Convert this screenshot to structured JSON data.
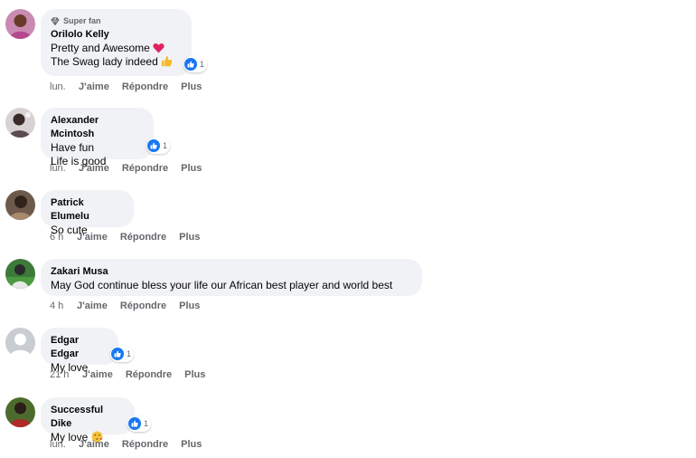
{
  "comments": [
    {
      "author": "Orilolo Kelly",
      "badge": "Super fan",
      "lines": [
        "Pretty and Awesome",
        "The Swag lady indeed"
      ],
      "reactions": "1",
      "time": "lun.",
      "actions": [
        "J'aime",
        "Répondre",
        "Plus"
      ]
    },
    {
      "author": "Alexander Mcintosh",
      "lines": [
        "Have fun",
        "Life is good"
      ],
      "reactions": "1",
      "time": "lun.",
      "actions": [
        "J'aime",
        "Répondre",
        "Plus"
      ]
    },
    {
      "author": "Patrick Elumelu",
      "lines": [
        "So cute"
      ],
      "time": "6 h",
      "actions": [
        "J'aime",
        "Répondre",
        "Plus"
      ]
    },
    {
      "author": "Zakari Musa",
      "lines": [
        "May God continue bless your life our African best player and world best"
      ],
      "time": "4 h",
      "actions": [
        "J'aime",
        "Répondre",
        "Plus"
      ]
    },
    {
      "author": "Edgar Edgar",
      "lines": [
        "My love"
      ],
      "reactions": "1",
      "time": "21 h",
      "actions": [
        "J'aime",
        "Répondre",
        "Plus"
      ]
    },
    {
      "author": "Successful Dike",
      "lines": [
        "My love"
      ],
      "reactions": "1",
      "time": "lun.",
      "actions": [
        "J'aime",
        "Répondre",
        "Plus"
      ]
    }
  ],
  "icons": {
    "reaction": "like-icon",
    "badge": "diamond-icon",
    "emoji_heart": "red-heart-emoji",
    "emoji_thumb": "thumbs-up-emoji",
    "emoji_kiss": "face-blowing-kiss-emoji"
  },
  "colors": {
    "bubble": "#f0f2f5",
    "like": "#1877f2",
    "meta": "#65676b"
  }
}
